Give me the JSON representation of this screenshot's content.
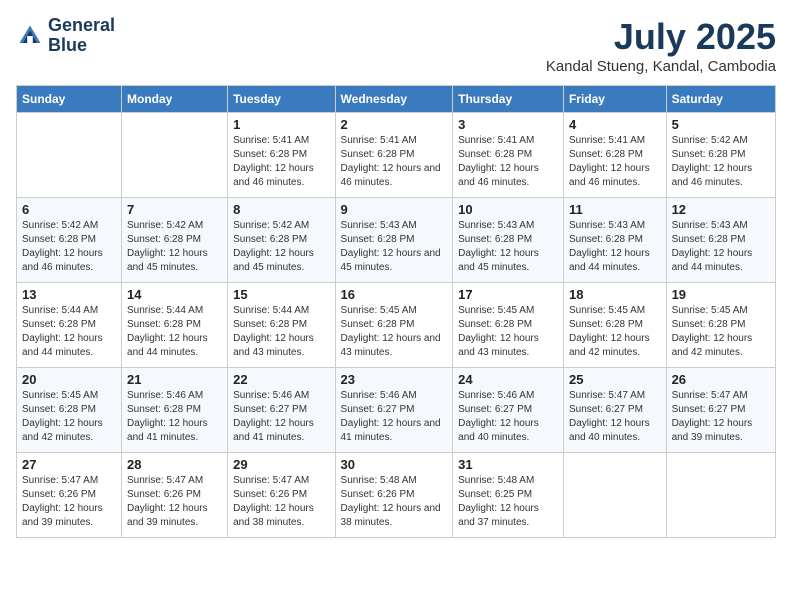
{
  "header": {
    "logo_line1": "General",
    "logo_line2": "Blue",
    "month_title": "July 2025",
    "location": "Kandal Stueng, Kandal, Cambodia"
  },
  "days_of_week": [
    "Sunday",
    "Monday",
    "Tuesday",
    "Wednesday",
    "Thursday",
    "Friday",
    "Saturday"
  ],
  "weeks": [
    [
      {
        "day": "",
        "info": ""
      },
      {
        "day": "",
        "info": ""
      },
      {
        "day": "1",
        "info": "Sunrise: 5:41 AM\nSunset: 6:28 PM\nDaylight: 12 hours and 46 minutes."
      },
      {
        "day": "2",
        "info": "Sunrise: 5:41 AM\nSunset: 6:28 PM\nDaylight: 12 hours and 46 minutes."
      },
      {
        "day": "3",
        "info": "Sunrise: 5:41 AM\nSunset: 6:28 PM\nDaylight: 12 hours and 46 minutes."
      },
      {
        "day": "4",
        "info": "Sunrise: 5:41 AM\nSunset: 6:28 PM\nDaylight: 12 hours and 46 minutes."
      },
      {
        "day": "5",
        "info": "Sunrise: 5:42 AM\nSunset: 6:28 PM\nDaylight: 12 hours and 46 minutes."
      }
    ],
    [
      {
        "day": "6",
        "info": "Sunrise: 5:42 AM\nSunset: 6:28 PM\nDaylight: 12 hours and 46 minutes."
      },
      {
        "day": "7",
        "info": "Sunrise: 5:42 AM\nSunset: 6:28 PM\nDaylight: 12 hours and 45 minutes."
      },
      {
        "day": "8",
        "info": "Sunrise: 5:42 AM\nSunset: 6:28 PM\nDaylight: 12 hours and 45 minutes."
      },
      {
        "day": "9",
        "info": "Sunrise: 5:43 AM\nSunset: 6:28 PM\nDaylight: 12 hours and 45 minutes."
      },
      {
        "day": "10",
        "info": "Sunrise: 5:43 AM\nSunset: 6:28 PM\nDaylight: 12 hours and 45 minutes."
      },
      {
        "day": "11",
        "info": "Sunrise: 5:43 AM\nSunset: 6:28 PM\nDaylight: 12 hours and 44 minutes."
      },
      {
        "day": "12",
        "info": "Sunrise: 5:43 AM\nSunset: 6:28 PM\nDaylight: 12 hours and 44 minutes."
      }
    ],
    [
      {
        "day": "13",
        "info": "Sunrise: 5:44 AM\nSunset: 6:28 PM\nDaylight: 12 hours and 44 minutes."
      },
      {
        "day": "14",
        "info": "Sunrise: 5:44 AM\nSunset: 6:28 PM\nDaylight: 12 hours and 44 minutes."
      },
      {
        "day": "15",
        "info": "Sunrise: 5:44 AM\nSunset: 6:28 PM\nDaylight: 12 hours and 43 minutes."
      },
      {
        "day": "16",
        "info": "Sunrise: 5:45 AM\nSunset: 6:28 PM\nDaylight: 12 hours and 43 minutes."
      },
      {
        "day": "17",
        "info": "Sunrise: 5:45 AM\nSunset: 6:28 PM\nDaylight: 12 hours and 43 minutes."
      },
      {
        "day": "18",
        "info": "Sunrise: 5:45 AM\nSunset: 6:28 PM\nDaylight: 12 hours and 42 minutes."
      },
      {
        "day": "19",
        "info": "Sunrise: 5:45 AM\nSunset: 6:28 PM\nDaylight: 12 hours and 42 minutes."
      }
    ],
    [
      {
        "day": "20",
        "info": "Sunrise: 5:45 AM\nSunset: 6:28 PM\nDaylight: 12 hours and 42 minutes."
      },
      {
        "day": "21",
        "info": "Sunrise: 5:46 AM\nSunset: 6:28 PM\nDaylight: 12 hours and 41 minutes."
      },
      {
        "day": "22",
        "info": "Sunrise: 5:46 AM\nSunset: 6:27 PM\nDaylight: 12 hours and 41 minutes."
      },
      {
        "day": "23",
        "info": "Sunrise: 5:46 AM\nSunset: 6:27 PM\nDaylight: 12 hours and 41 minutes."
      },
      {
        "day": "24",
        "info": "Sunrise: 5:46 AM\nSunset: 6:27 PM\nDaylight: 12 hours and 40 minutes."
      },
      {
        "day": "25",
        "info": "Sunrise: 5:47 AM\nSunset: 6:27 PM\nDaylight: 12 hours and 40 minutes."
      },
      {
        "day": "26",
        "info": "Sunrise: 5:47 AM\nSunset: 6:27 PM\nDaylight: 12 hours and 39 minutes."
      }
    ],
    [
      {
        "day": "27",
        "info": "Sunrise: 5:47 AM\nSunset: 6:26 PM\nDaylight: 12 hours and 39 minutes."
      },
      {
        "day": "28",
        "info": "Sunrise: 5:47 AM\nSunset: 6:26 PM\nDaylight: 12 hours and 39 minutes."
      },
      {
        "day": "29",
        "info": "Sunrise: 5:47 AM\nSunset: 6:26 PM\nDaylight: 12 hours and 38 minutes."
      },
      {
        "day": "30",
        "info": "Sunrise: 5:48 AM\nSunset: 6:26 PM\nDaylight: 12 hours and 38 minutes."
      },
      {
        "day": "31",
        "info": "Sunrise: 5:48 AM\nSunset: 6:25 PM\nDaylight: 12 hours and 37 minutes."
      },
      {
        "day": "",
        "info": ""
      },
      {
        "day": "",
        "info": ""
      }
    ]
  ]
}
